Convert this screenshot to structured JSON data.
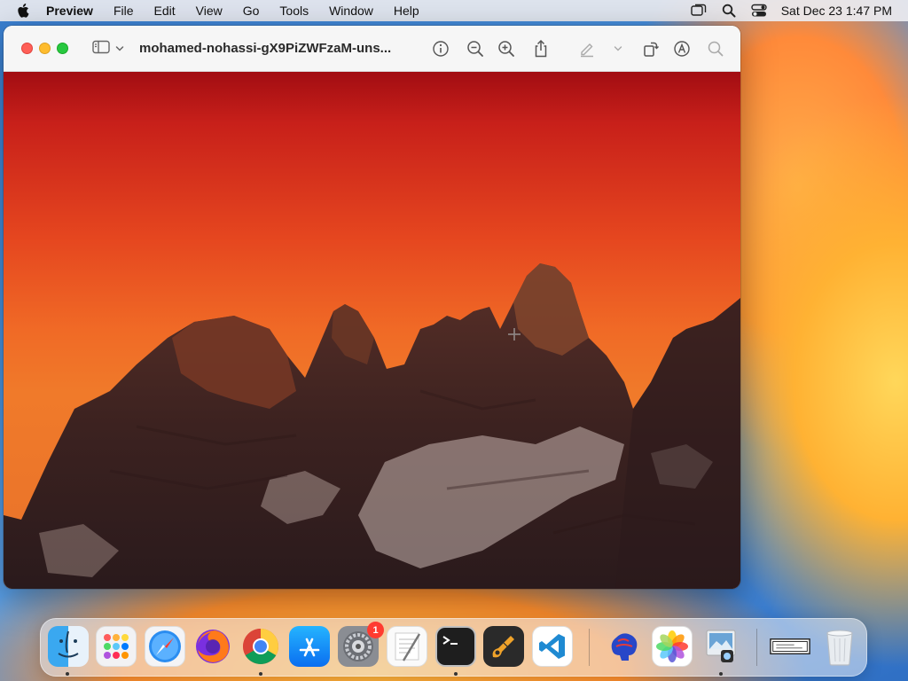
{
  "menubar": {
    "app_name": "Preview",
    "items": [
      "File",
      "Edit",
      "View",
      "Go",
      "Tools",
      "Window",
      "Help"
    ],
    "clock": "Sat Dec 23  1:47 PM",
    "status_icons": [
      "window-stack-icon",
      "search-icon",
      "control-center-icon"
    ]
  },
  "window": {
    "title": "mohamed-nohassi-gX9PiZWFzaM-uns...",
    "toolbar_icons": [
      "info-icon",
      "zoom-out-icon",
      "zoom-in-icon",
      "share-icon",
      "markup-highlight-icon",
      "chevron-down-icon",
      "rotate-icon",
      "markup-icon",
      "search-icon"
    ]
  },
  "dock": {
    "apps": [
      {
        "name": "Finder",
        "icon": "finder-icon",
        "running": true
      },
      {
        "name": "Launchpad",
        "icon": "launchpad-icon",
        "running": false
      },
      {
        "name": "Safari",
        "icon": "safari-icon",
        "running": false
      },
      {
        "name": "Firefox",
        "icon": "firefox-icon",
        "running": false
      },
      {
        "name": "Google Chrome",
        "icon": "chrome-icon",
        "running": true
      },
      {
        "name": "App Store",
        "icon": "app-store-icon",
        "running": false
      },
      {
        "name": "System Settings",
        "icon": "system-settings-icon",
        "running": false,
        "badge": "1"
      },
      {
        "name": "TextEdit",
        "icon": "textedit-icon",
        "running": false
      },
      {
        "name": "Terminal",
        "icon": "terminal-icon",
        "running": true
      },
      {
        "name": "GarageBand",
        "icon": "garageband-icon",
        "running": false
      },
      {
        "name": "Visual Studio Code",
        "icon": "vscode-icon",
        "running": false
      },
      {
        "name": "Brain app",
        "icon": "brain-icon",
        "running": false
      },
      {
        "name": "Photos",
        "icon": "photos-icon",
        "running": false
      },
      {
        "name": "Preview",
        "icon": "preview-icon",
        "running": true
      },
      {
        "name": "Document",
        "icon": "document-icon",
        "running": false
      },
      {
        "name": "Trash",
        "icon": "trash-icon",
        "running": false
      }
    ]
  }
}
